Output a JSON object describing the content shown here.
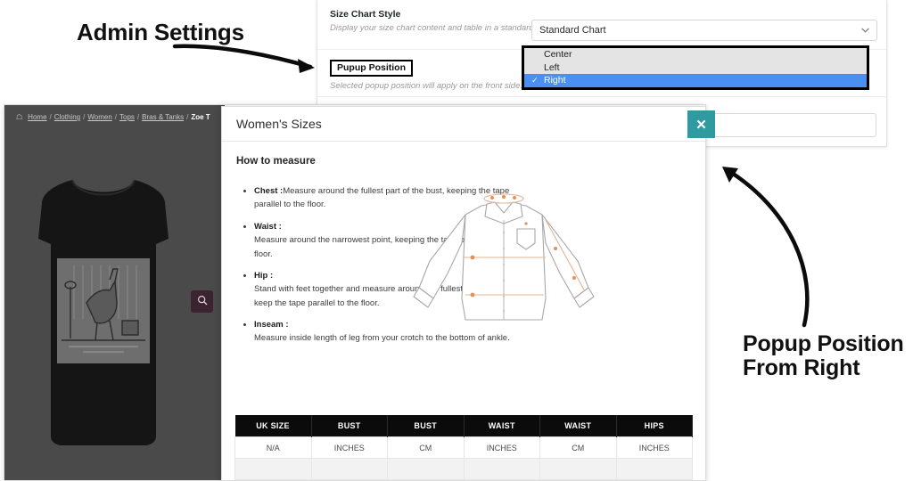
{
  "annotations": {
    "admin": "Admin Settings",
    "popup": "Popup Position\nFrom Right"
  },
  "admin_panel": {
    "size_chart_style": {
      "label": "Size Chart Style",
      "description": "Display your size chart content and table in a standard view or as a tabbed view."
    },
    "popup_position": {
      "label": "Pupup Position",
      "description": "Selected popup position will apply on the front side. The default position is \"Center\"."
    },
    "select": {
      "value": "Standard Chart",
      "chevron_icon": "chevron-down-icon"
    },
    "dropdown": {
      "options": [
        {
          "label": "Center",
          "selected": false
        },
        {
          "label": "Left",
          "selected": false
        },
        {
          "label": "Right",
          "selected": true
        }
      ],
      "check_glyph": "✓",
      "highlight_color": "#4a90f0"
    }
  },
  "storefront": {
    "breadcrumb": {
      "home_icon": "home-icon",
      "items": [
        "Home",
        "Clothing",
        "Women",
        "Tops",
        "Bras & Tanks"
      ],
      "current": "Zoe T",
      "separator": "/"
    },
    "product": {
      "alt_name": "black-tank-top",
      "zoom_icon": "magnifier-icon"
    }
  },
  "modal": {
    "title": "Women's Sizes",
    "close_icon": "close-icon",
    "close_color": "#2f9aa0",
    "how_to_measure": "How to measure",
    "measurements": [
      {
        "term": "Chest :",
        "text": "Measure around the fullest part of the bust, keeping the tape parallel to the floor.",
        "wide": false
      },
      {
        "term": "Waist :",
        "text": "Measure around the narrowest point, keeping the tape parallel to the floor.",
        "wide": false
      },
      {
        "term": "Hip :",
        "text": "Stand with feet together and measure around the fullest point of the hip, keep the tape parallel to the floor.",
        "wide": true
      },
      {
        "term": "Inseam :",
        "text": "Measure inside length of leg from your crotch to the bottom of ankle.",
        "wide": true
      }
    ],
    "figure": {
      "name": "dress-shirt-measure-diagram",
      "accent_color": "#e2915b"
    },
    "size_table": {
      "headers": [
        "UK SIZE",
        "BUST",
        "BUST",
        "WAIST",
        "WAIST",
        "HIPS"
      ],
      "rows": [
        [
          "N/A",
          "INCHES",
          "CM",
          "INCHES",
          "CM",
          "INCHES"
        ],
        [
          "",
          "",
          "",
          "",
          "",
          ""
        ]
      ]
    }
  }
}
